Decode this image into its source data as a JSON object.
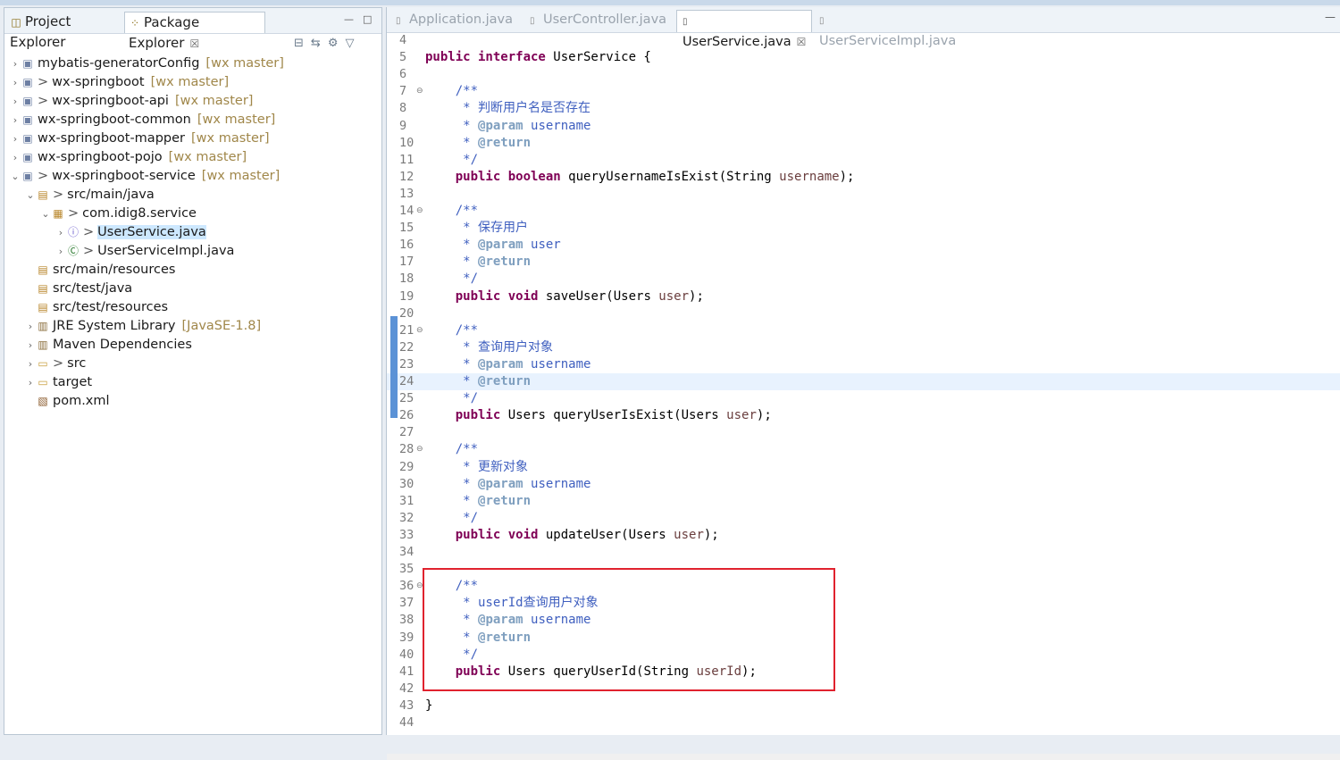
{
  "left_panel": {
    "tabs": [
      {
        "label": "Project Explorer"
      },
      {
        "label": "Package Explorer",
        "close": "☒"
      }
    ],
    "window_buttons": [
      "—",
      "□"
    ],
    "toolbar": [
      "⊟",
      "⇆",
      "⚙",
      "▽"
    ],
    "tree": [
      {
        "label": "mybatis-generatorConfig",
        "decoration": "[wx master]",
        "prefix": "",
        "icon": "project-icon",
        "twisty": "›",
        "selected": false
      },
      {
        "label": "wx-springboot",
        "decoration": "[wx master]",
        "prefix": ">",
        "icon": "project-icon",
        "twisty": "›",
        "selected": false
      },
      {
        "label": "wx-springboot-api",
        "decoration": "[wx master]",
        "prefix": ">",
        "icon": "project-icon",
        "twisty": "›",
        "selected": false
      },
      {
        "label": "wx-springboot-common",
        "decoration": "[wx master]",
        "prefix": "",
        "icon": "project-icon",
        "twisty": "›",
        "selected": false
      },
      {
        "label": "wx-springboot-mapper",
        "decoration": "[wx master]",
        "prefix": "",
        "icon": "project-icon",
        "twisty": "›",
        "selected": false
      },
      {
        "label": "wx-springboot-pojo",
        "decoration": "[wx master]",
        "prefix": "",
        "icon": "project-icon",
        "twisty": "›",
        "selected": false
      },
      {
        "label": "wx-springboot-service",
        "decoration": "[wx master]",
        "prefix": ">",
        "icon": "project-icon",
        "twisty": "⌄",
        "selected": false
      },
      {
        "label": "src/main/java",
        "decoration": "",
        "prefix": ">",
        "icon": "source-folder-icon",
        "twisty": "⌄",
        "selected": false
      },
      {
        "label": "com.idig8.service",
        "decoration": "",
        "prefix": ">",
        "icon": "package-icon",
        "twisty": "⌄",
        "selected": false
      },
      {
        "label": "UserService.java",
        "decoration": "",
        "prefix": ">",
        "icon": "java-interface-icon",
        "twisty": "›",
        "selected": true
      },
      {
        "label": "UserServiceImpl.java",
        "decoration": "",
        "prefix": ">",
        "icon": "java-class-icon",
        "twisty": "›",
        "selected": false
      },
      {
        "label": "src/main/resources",
        "decoration": "",
        "prefix": "",
        "icon": "source-folder-icon",
        "twisty": "",
        "selected": false
      },
      {
        "label": "src/test/java",
        "decoration": "",
        "prefix": "",
        "icon": "source-folder-icon",
        "twisty": "",
        "selected": false
      },
      {
        "label": "src/test/resources",
        "decoration": "",
        "prefix": "",
        "icon": "source-folder-icon",
        "twisty": "",
        "selected": false
      },
      {
        "label": "JRE System Library",
        "decoration": "[JavaSE-1.8]",
        "prefix": "",
        "icon": "library-icon",
        "twisty": "›",
        "selected": false
      },
      {
        "label": "Maven Dependencies",
        "decoration": "",
        "prefix": "",
        "icon": "library-icon",
        "twisty": "›",
        "selected": false
      },
      {
        "label": "src",
        "decoration": "",
        "prefix": ">",
        "icon": "folder-icon",
        "twisty": "›",
        "selected": false
      },
      {
        "label": "target",
        "decoration": "",
        "prefix": "",
        "icon": "folder-icon",
        "twisty": "›",
        "selected": false
      },
      {
        "label": "pom.xml",
        "decoration": "",
        "prefix": "",
        "icon": "xml-file-icon",
        "twisty": "",
        "selected": false
      }
    ]
  },
  "editor": {
    "tabs": [
      {
        "label": "Application.java",
        "active": false
      },
      {
        "label": "UserController.java",
        "active": false
      },
      {
        "label": "UserService.java",
        "active": true,
        "close": "☒"
      },
      {
        "label": "UserServiceImpl.java",
        "active": false
      }
    ],
    "minimize": "—",
    "lines": [
      {
        "num": "4",
        "fold": "",
        "seg": []
      },
      {
        "num": "5",
        "fold": "",
        "seg": [
          {
            "t": "public interface",
            "c": "kw"
          },
          {
            "t": " UserService {",
            "c": ""
          }
        ]
      },
      {
        "num": "6",
        "fold": "",
        "seg": []
      },
      {
        "num": "7",
        "fold": "⊖",
        "seg": [
          {
            "t": "    /**",
            "c": "cm"
          }
        ]
      },
      {
        "num": "8",
        "fold": "",
        "seg": [
          {
            "t": "     * ",
            "c": "cm"
          },
          {
            "t": "判断用户名是否存在",
            "c": "cm zh"
          }
        ]
      },
      {
        "num": "9",
        "fold": "",
        "seg": [
          {
            "t": "     * ",
            "c": "cm"
          },
          {
            "t": "@param",
            "c": "tag"
          },
          {
            "t": " username",
            "c": "cm"
          }
        ]
      },
      {
        "num": "10",
        "fold": "",
        "seg": [
          {
            "t": "     * ",
            "c": "cm"
          },
          {
            "t": "@return",
            "c": "tag"
          }
        ]
      },
      {
        "num": "11",
        "fold": "",
        "seg": [
          {
            "t": "     */",
            "c": "cm"
          }
        ]
      },
      {
        "num": "12",
        "fold": "",
        "seg": [
          {
            "t": "    ",
            "c": ""
          },
          {
            "t": "public boolean",
            "c": "kw"
          },
          {
            "t": " queryUsernameIsExist(String ",
            "c": ""
          },
          {
            "t": "username",
            "c": "param"
          },
          {
            "t": ");",
            "c": ""
          }
        ]
      },
      {
        "num": "13",
        "fold": "",
        "seg": []
      },
      {
        "num": "14",
        "fold": "⊖",
        "seg": [
          {
            "t": "    /**",
            "c": "cm"
          }
        ]
      },
      {
        "num": "15",
        "fold": "",
        "seg": [
          {
            "t": "     * ",
            "c": "cm"
          },
          {
            "t": "保存用户",
            "c": "cm zh"
          }
        ]
      },
      {
        "num": "16",
        "fold": "",
        "seg": [
          {
            "t": "     * ",
            "c": "cm"
          },
          {
            "t": "@param",
            "c": "tag"
          },
          {
            "t": " user",
            "c": "cm"
          }
        ]
      },
      {
        "num": "17",
        "fold": "",
        "seg": [
          {
            "t": "     * ",
            "c": "cm"
          },
          {
            "t": "@return",
            "c": "tag"
          }
        ]
      },
      {
        "num": "18",
        "fold": "",
        "seg": [
          {
            "t": "     */",
            "c": "cm"
          }
        ]
      },
      {
        "num": "19",
        "fold": "",
        "seg": [
          {
            "t": "    ",
            "c": ""
          },
          {
            "t": "public void",
            "c": "kw"
          },
          {
            "t": " saveUser(Users ",
            "c": ""
          },
          {
            "t": "user",
            "c": "param"
          },
          {
            "t": ");",
            "c": ""
          }
        ]
      },
      {
        "num": "20",
        "fold": "",
        "seg": []
      },
      {
        "num": "21",
        "fold": "⊖",
        "seg": [
          {
            "t": "    /**",
            "c": "cm"
          }
        ]
      },
      {
        "num": "22",
        "fold": "",
        "seg": [
          {
            "t": "     * ",
            "c": "cm"
          },
          {
            "t": "查询用户对象",
            "c": "cm zh"
          }
        ]
      },
      {
        "num": "23",
        "fold": "",
        "seg": [
          {
            "t": "     * ",
            "c": "cm"
          },
          {
            "t": "@param",
            "c": "tag"
          },
          {
            "t": " username",
            "c": "cm"
          }
        ]
      },
      {
        "num": "24",
        "fold": "",
        "hl": true,
        "seg": [
          {
            "t": "     * ",
            "c": "cm"
          },
          {
            "t": "@return",
            "c": "tag"
          }
        ]
      },
      {
        "num": "25",
        "fold": "",
        "seg": [
          {
            "t": "     */",
            "c": "cm"
          }
        ]
      },
      {
        "num": "26",
        "fold": "",
        "seg": [
          {
            "t": "    ",
            "c": ""
          },
          {
            "t": "public",
            "c": "kw"
          },
          {
            "t": " Users queryUserIsExist(Users ",
            "c": ""
          },
          {
            "t": "user",
            "c": "param"
          },
          {
            "t": ");",
            "c": ""
          }
        ]
      },
      {
        "num": "27",
        "fold": "",
        "seg": []
      },
      {
        "num": "28",
        "fold": "⊖",
        "seg": [
          {
            "t": "    /**",
            "c": "cm"
          }
        ]
      },
      {
        "num": "29",
        "fold": "",
        "seg": [
          {
            "t": "     * ",
            "c": "cm"
          },
          {
            "t": "更新对象",
            "c": "cm zh"
          }
        ]
      },
      {
        "num": "30",
        "fold": "",
        "seg": [
          {
            "t": "     * ",
            "c": "cm"
          },
          {
            "t": "@param",
            "c": "tag"
          },
          {
            "t": " username",
            "c": "cm"
          }
        ]
      },
      {
        "num": "31",
        "fold": "",
        "seg": [
          {
            "t": "     * ",
            "c": "cm"
          },
          {
            "t": "@return",
            "c": "tag"
          }
        ]
      },
      {
        "num": "32",
        "fold": "",
        "seg": [
          {
            "t": "     */",
            "c": "cm"
          }
        ]
      },
      {
        "num": "33",
        "fold": "",
        "seg": [
          {
            "t": "    ",
            "c": ""
          },
          {
            "t": "public void",
            "c": "kw"
          },
          {
            "t": " updateUser(Users ",
            "c": ""
          },
          {
            "t": "user",
            "c": "param"
          },
          {
            "t": ");",
            "c": ""
          }
        ]
      },
      {
        "num": "34",
        "fold": "",
        "seg": []
      },
      {
        "num": "35",
        "fold": "",
        "seg": []
      },
      {
        "num": "36",
        "fold": "⊖",
        "seg": [
          {
            "t": "    /**",
            "c": "cm"
          }
        ]
      },
      {
        "num": "37",
        "fold": "",
        "seg": [
          {
            "t": "     * userId",
            "c": "cm"
          },
          {
            "t": "查询用户对象",
            "c": "cm zh"
          }
        ]
      },
      {
        "num": "38",
        "fold": "",
        "seg": [
          {
            "t": "     * ",
            "c": "cm"
          },
          {
            "t": "@param",
            "c": "tag"
          },
          {
            "t": " username",
            "c": "cm"
          }
        ]
      },
      {
        "num": "39",
        "fold": "",
        "seg": [
          {
            "t": "     * ",
            "c": "cm"
          },
          {
            "t": "@return",
            "c": "tag"
          }
        ]
      },
      {
        "num": "40",
        "fold": "",
        "seg": [
          {
            "t": "     */",
            "c": "cm"
          }
        ]
      },
      {
        "num": "41",
        "fold": "",
        "seg": [
          {
            "t": "    ",
            "c": ""
          },
          {
            "t": "public",
            "c": "kw"
          },
          {
            "t": " Users queryUserId(String ",
            "c": ""
          },
          {
            "t": "userId",
            "c": "param"
          },
          {
            "t": ");",
            "c": ""
          }
        ]
      },
      {
        "num": "42",
        "fold": "",
        "seg": []
      },
      {
        "num": "43",
        "fold": "",
        "seg": [
          {
            "t": "}",
            "c": ""
          }
        ]
      },
      {
        "num": "44",
        "fold": "",
        "seg": []
      }
    ]
  },
  "colors": {
    "keyword": "#7f0055",
    "javadoc": "#3f5fbf",
    "javadoc_tag": "#7f9fbf",
    "parameter": "#6a3e3e",
    "highlight_box": "#e0222e",
    "selection": "#cde8ff"
  }
}
